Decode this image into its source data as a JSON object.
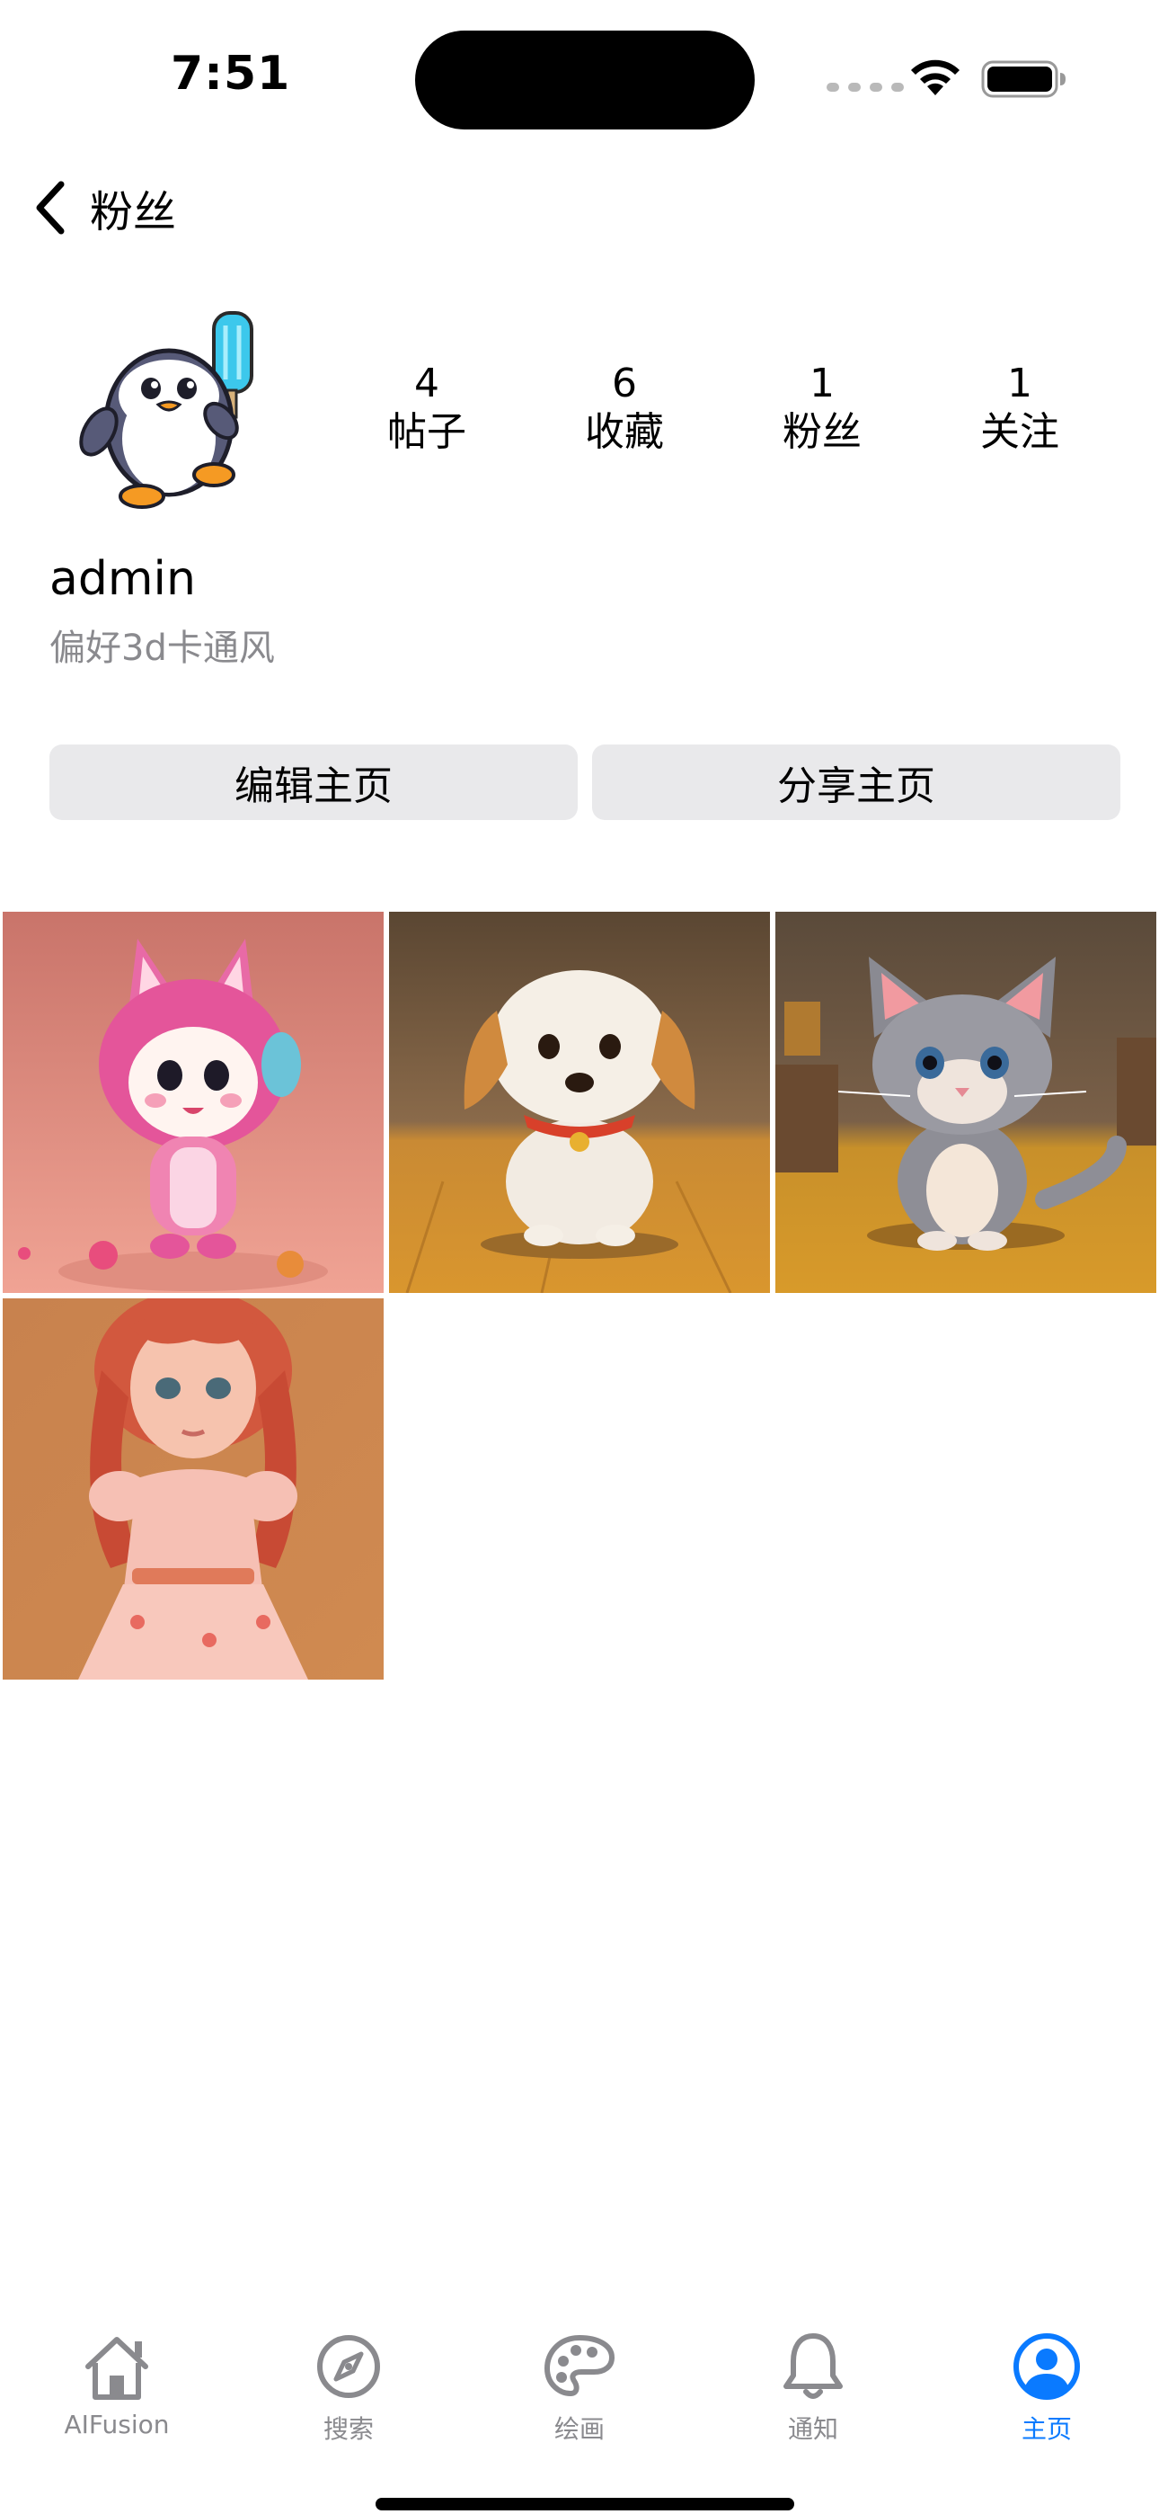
{
  "status_bar": {
    "time": "7:51"
  },
  "nav": {
    "title": "粉丝"
  },
  "profile": {
    "username": "admin",
    "bio": "偏好3d卡通风",
    "stats": [
      {
        "value": "4",
        "label": "帖子"
      },
      {
        "value": "6",
        "label": "收藏"
      },
      {
        "value": "1",
        "label": "粉丝"
      },
      {
        "value": "1",
        "label": "关注"
      }
    ]
  },
  "actions": {
    "edit_label": "编辑主页",
    "share_label": "分享主页"
  },
  "posts": [
    {
      "subject": "pink-bunny-character"
    },
    {
      "subject": "puppy"
    },
    {
      "subject": "kitten"
    },
    {
      "subject": "girl-figurine"
    }
  ],
  "tabbar": {
    "items": [
      {
        "label": "AIFusion",
        "icon": "house-icon",
        "active": false
      },
      {
        "label": "搜索",
        "icon": "compass-icon",
        "active": false
      },
      {
        "label": "绘画",
        "icon": "palette-icon",
        "active": false
      },
      {
        "label": "通知",
        "icon": "bell-icon",
        "active": false
      },
      {
        "label": "主页",
        "icon": "person-circle-icon",
        "active": true
      }
    ]
  },
  "colors": {
    "accent": "#0a7aff",
    "inactive": "#8a8a8e",
    "button_bg": "#e9e9eb"
  }
}
